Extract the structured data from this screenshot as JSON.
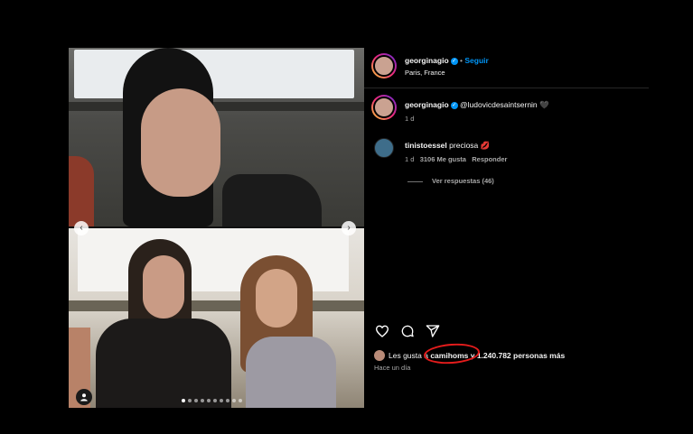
{
  "header": {
    "username": "georginagio",
    "separator": "•",
    "follow_label": "Seguir",
    "location": "Paris, France"
  },
  "caption": {
    "username": "georginagio",
    "mention": "@ludovicdesaintsernin",
    "emoji": "🖤",
    "time": "1 d"
  },
  "comment": {
    "username": "tinistoessel",
    "text": "preciosa",
    "emoji": "💋",
    "time": "1 d",
    "likes": "3106 Me gusta",
    "reply_label": "Responder",
    "view_replies": "Ver respuestas (46)"
  },
  "likes": {
    "prefix": "Les gusta a",
    "user": "camihoms",
    "suffix": "y 1.240.782 personas más",
    "time": "Hace un día"
  },
  "carousel": {
    "prev": "‹",
    "next": "›",
    "dot_count": 10,
    "active_index": 0
  },
  "icons": {
    "like": "heart-icon",
    "comment": "comment-icon",
    "share": "share-icon",
    "verified": "verified-badge-icon",
    "tag": "user-tag-icon"
  },
  "colors": {
    "accent": "#0095f6",
    "annotation": "#e41c1c"
  }
}
